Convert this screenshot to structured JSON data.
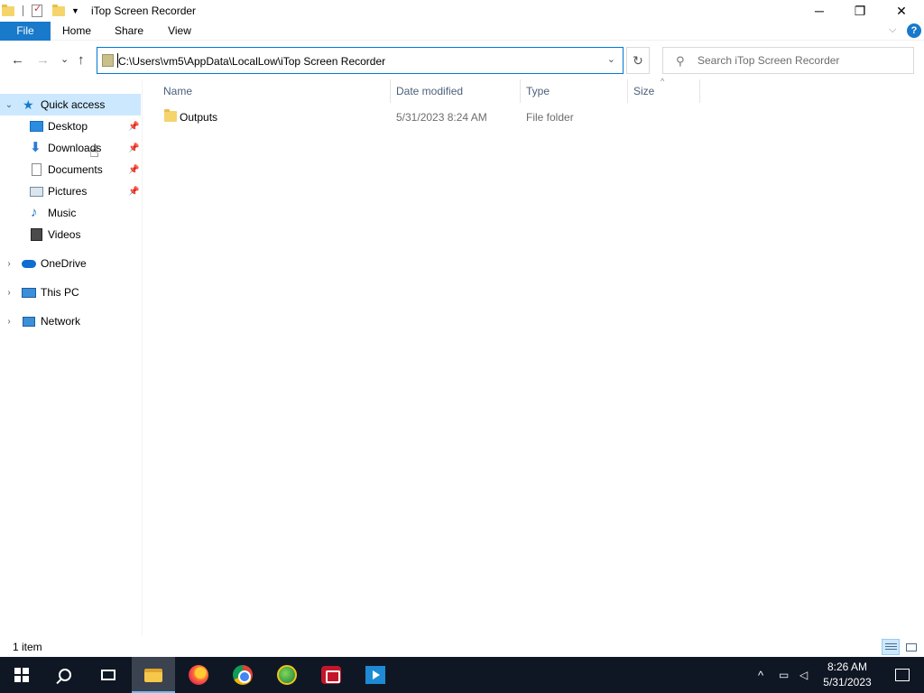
{
  "window": {
    "title": "iTop Screen Recorder",
    "minimize_icon": "─",
    "restore_icon": "❐",
    "close_icon": "✕"
  },
  "qat": {
    "dropdown_icon": "▼"
  },
  "ribbon": {
    "tabs": [
      {
        "label": "File"
      },
      {
        "label": "Home"
      },
      {
        "label": "Share"
      },
      {
        "label": "View"
      }
    ],
    "expand_icon": "⌵",
    "help_icon": "?"
  },
  "nav": {
    "back_icon": "←",
    "forward_icon": "→",
    "recent_icon": "⌄",
    "up_icon": "↑",
    "address": "C:\\Users\\vm5\\AppData\\LocalLow\\iTop Screen Recorder",
    "address_dropdown_icon": "⌄",
    "refresh_icon": "↻",
    "search_placeholder": "Search iTop Screen Recorder",
    "search_icon": "⚲"
  },
  "sidebar": {
    "expand_collapsed": "›",
    "expand_open": "⌄",
    "pin_icon": "📌",
    "items": [
      {
        "label": "Quick access",
        "icon": "star-icon",
        "glyph": "★"
      },
      {
        "label": "Desktop",
        "icon": "desktop-icon"
      },
      {
        "label": "Downloads",
        "icon": "download-icon",
        "glyph": "⬇"
      },
      {
        "label": "Documents",
        "icon": "documents-icon"
      },
      {
        "label": "Pictures",
        "icon": "pictures-icon"
      },
      {
        "label": "Music",
        "icon": "music-icon",
        "glyph": "♪"
      },
      {
        "label": "Videos",
        "icon": "videos-icon"
      },
      {
        "label": "OneDrive",
        "icon": "onedrive-icon"
      },
      {
        "label": "This PC",
        "icon": "this-pc-icon"
      },
      {
        "label": "Network",
        "icon": "network-icon"
      }
    ]
  },
  "columns": [
    {
      "label": "Name"
    },
    {
      "label": "Date modified"
    },
    {
      "label": "Type"
    },
    {
      "label": "Size"
    }
  ],
  "sort_icon": "^",
  "files": [
    {
      "name": "Outputs",
      "date_modified": "5/31/2023 8:24 AM",
      "type": "File folder",
      "size": ""
    }
  ],
  "status": {
    "item_count": "1 item"
  },
  "taskbar": {
    "tray_chevron": "^",
    "time": "8:26 AM",
    "date": "5/31/2023",
    "colors": {
      "background": "#101724",
      "accent": "#76b9ed"
    }
  },
  "cursor_icon": "☝",
  "colors": {
    "accent": "#1979ca",
    "selection": "#cce8ff",
    "header_text": "#4c607a"
  }
}
